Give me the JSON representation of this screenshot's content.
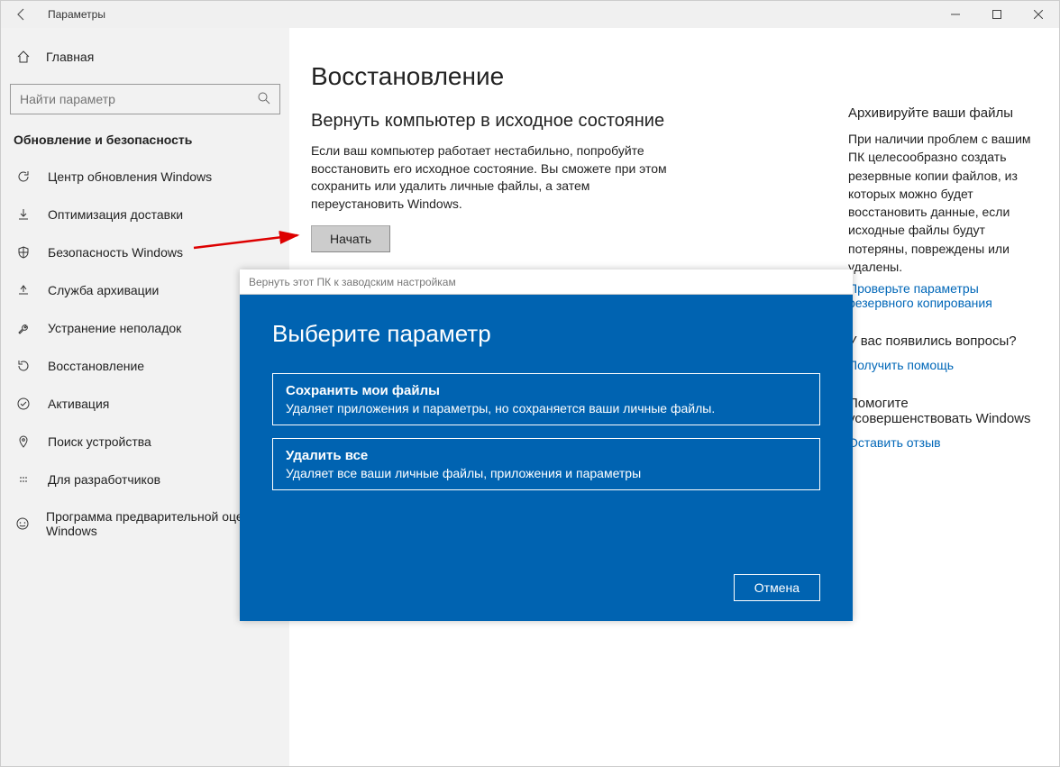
{
  "window": {
    "title": "Параметры"
  },
  "sidebar": {
    "home": "Главная",
    "search_placeholder": "Найти параметр",
    "category": "Обновление и безопасность",
    "items": [
      {
        "label": "Центр обновления Windows",
        "icon": "sync"
      },
      {
        "label": "Оптимизация доставки",
        "icon": "download"
      },
      {
        "label": "Безопасность Windows",
        "icon": "shield"
      },
      {
        "label": "Служба архивации",
        "icon": "backup"
      },
      {
        "label": "Устранение неполадок",
        "icon": "troubleshoot"
      },
      {
        "label": "Восстановление",
        "icon": "recovery"
      },
      {
        "label": "Активация",
        "icon": "activation"
      },
      {
        "label": "Поиск устройства",
        "icon": "find-device"
      },
      {
        "label": "Для разработчиков",
        "icon": "developer"
      },
      {
        "label": "Программа предварительной оценки Windows",
        "icon": "insider"
      }
    ]
  },
  "main": {
    "page_title": "Восстановление",
    "section_title": "Вернуть компьютер в исходное состояние",
    "section_text": "Если ваш компьютер работает нестабильно, попробуйте восстановить его исходное состояние. Вы сможете при этом сохранить или удалить личные файлы, а затем переустановить Windows.",
    "start_button": "Начать"
  },
  "aside": {
    "g1_title": "Архивируйте ваши файлы",
    "g1_text": "При наличии проблем с вашим ПК целесообразно создать резервные копии файлов, из которых можно будет восстановить данные, если исходные файлы будут потеряны, повреждены или удалены.",
    "g1_link": "Проверьте параметры резервного копирования",
    "g2_title": "У вас появились вопросы?",
    "g2_link": "Получить помощь",
    "g3_title": "Помогите усовершенствовать Windows",
    "g3_link": "Оставить отзыв"
  },
  "dialog": {
    "header": "Вернуть этот ПК к заводским настройкам",
    "title": "Выберите параметр",
    "options": [
      {
        "title": "Сохранить мои файлы",
        "text": "Удаляет приложения и параметры, но сохраняется ваши личные файлы."
      },
      {
        "title": "Удалить все",
        "text": "Удаляет все ваши личные файлы, приложения и параметры"
      }
    ],
    "cancel": "Отмена"
  }
}
